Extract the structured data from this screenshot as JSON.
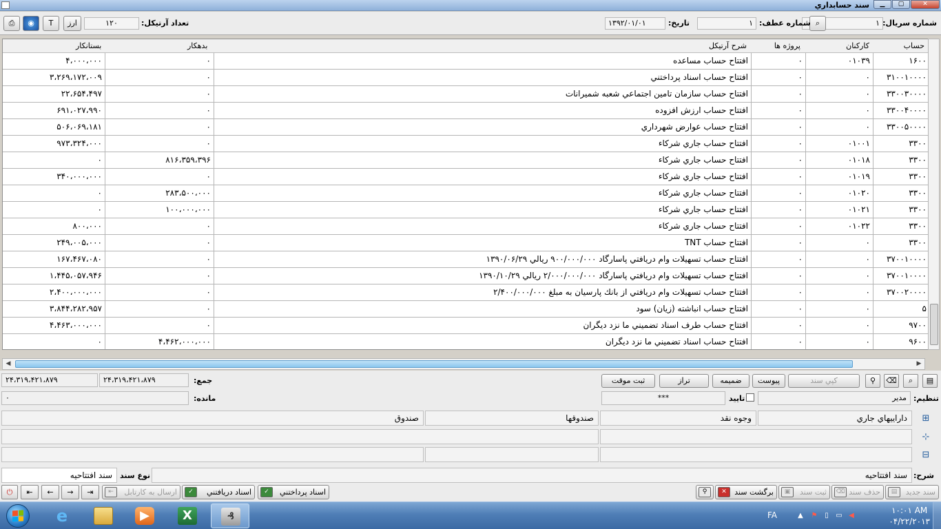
{
  "window": {
    "title": "سند حسابداري",
    "min": "▁",
    "max": "▢",
    "close": "✕"
  },
  "header": {
    "serial_label": "شماره سريال:",
    "serial_value": "۱",
    "atf_label": "شماره عطف:",
    "atf_value": "۱",
    "date_label": "تاريخ:",
    "date_value": "۱۳۹۲/۰۱/۰۱",
    "article_count_label": "تعداد آرتيكل:",
    "article_count_value": "۱۲۰",
    "btn_arz": "ارز",
    "btn_t": "T"
  },
  "grid": {
    "columns": [
      "حساب",
      "كاركنان",
      "پروژه ها",
      "شرح آرتيكل",
      "بدهكار",
      "بستانكار"
    ],
    "rows": [
      [
        "۱۶۰۰",
        "۰۱۰۳۹",
        "۰",
        "افتتاح حساب مساعده",
        "۰",
        "۴،۰۰۰،۰۰۰"
      ],
      [
        "۳۱۰۰۱۰۰۰۰",
        "۰",
        "۰",
        "افتتاح حساب اسناد پرداختني",
        "۰",
        "۳،۲۶۹،۱۷۲،۰۰۹"
      ],
      [
        "۳۳۰۰۳۰۰۰۰",
        "۰",
        "۰",
        "افتتاح حساب سازمان تامين اجتماعي شعبه شميرانات",
        "۰",
        "۲۲،۶۵۴،۴۹۷"
      ],
      [
        "۳۳۰۰۴۰۰۰۰",
        "۰",
        "۰",
        "افتتاح حساب ارزش افزوده",
        "۰",
        "۶۹۱،۰۲۷،۹۹۰"
      ],
      [
        "۳۳۰۰۵۰۰۰۰",
        "۰",
        "۰",
        "افتتاح حساب عوارض شهرداري",
        "۰",
        "۵۰۶،۰۶۹،۱۸۱"
      ],
      [
        "۳۳۰۰",
        "۰۱۰۰۱",
        "۰",
        "افتتاح حساب جاري شركاء",
        "۰",
        "۹۷۳،۳۲۴،۰۰۰"
      ],
      [
        "۳۳۰۰",
        "۰۱۰۱۸",
        "۰",
        "افتتاح حساب جاري شركاء",
        "۸۱۶،۳۵۹،۳۹۶",
        "۰"
      ],
      [
        "۳۳۰۰",
        "۰۱۰۱۹",
        "۰",
        "افتتاح حساب جاري شركاء",
        "۰",
        "۳۴۰،۰۰۰،۰۰۰"
      ],
      [
        "۳۳۰۰",
        "۰۱۰۲۰",
        "۰",
        "افتتاح حساب جاري شركاء",
        "۲۸۳،۵۰۰،۰۰۰",
        "۰"
      ],
      [
        "۳۳۰۰",
        "۰۱۰۲۱",
        "۰",
        "افتتاح حساب جاري شركاء",
        "۱۰۰،۰۰۰،۰۰۰",
        "۰"
      ],
      [
        "۳۳۰۰",
        "۰۱۰۲۲",
        "۰",
        "افتتاح حساب جاري شركاء",
        "۰",
        "۸۰۰،۰۰۰"
      ],
      [
        "۳۳۰۰",
        "۰",
        "۰",
        "افتتاح حساب TNT",
        "۰",
        "۲۴۹،۰۰۵،۰۰۰"
      ],
      [
        "۳۷۰۰۱۰۰۰۰",
        "۰",
        "۰",
        "افتتاح حساب تسهيلات وام دريافتي پاسارگاد ۹۰۰/۰۰۰/۰۰۰ ريالي ۱۳۹۰/۰۶/۲۹",
        "۰",
        "۱۶۷،۴۶۷،۰۸۰"
      ],
      [
        "۳۷۰۰۱۰۰۰۰",
        "۰",
        "۰",
        "افتتاح حساب تسهيلات وام دريافتي پاسارگاد ۲/۰۰۰/۰۰۰/۰۰۰ ريالي ۱۳۹۰/۱۰/۲۹",
        "۰",
        "۱،۴۴۵،۰۵۷،۹۴۶"
      ],
      [
        "۳۷۰۰۲۰۰۰۰",
        "۰",
        "۰",
        "افتتاح حساب تسهيلات وام دريافتي از بانك پارسيان به مبلغ ۲/۴۰۰/۰۰۰/۰۰۰",
        "۰",
        "۲،۴۰۰،۰۰۰،۰۰۰"
      ],
      [
        "۵",
        "۰",
        "۰",
        "افتتاح حساب انباشته (زيان) سود",
        "۰",
        "۳،۸۴۴،۲۸۲،۹۵۷"
      ],
      [
        "۹۷۰۰",
        "۰",
        "۰",
        "افتتاح حساب طرف اسناد تضميني ما نزد ديگران",
        "۰",
        "۴،۴۶۳،۰۰۰،۰۰۰"
      ],
      [
        "۹۶۰۰",
        "۰",
        "۰",
        "افتتاح حساب اسناد تضميني ما نزد ديگران",
        "۴،۴۶۲،۰۰۰،۰۰۰",
        "۰"
      ]
    ]
  },
  "summary": {
    "btn_temp": "ثبت موقت",
    "btn_balance": "تراز",
    "btn_attach": "ضميمه",
    "btn_pivot": "پيوست",
    "btn_copy": "كپي سند",
    "sum_label": "جمع:",
    "sum_debit": "۲۴،۳۱۹،۴۲۱،۸۷۹",
    "sum_credit": "۲۴،۳۱۹،۴۲۱،۸۷۹",
    "remain_label": "مانده:",
    "remain_value": "۰",
    "arrange_label": "تنظيم:",
    "arrange_value": "مدير",
    "approve_label": "تاييد",
    "approve_value": "***"
  },
  "accounts": {
    "row1": [
      "داراييهاي جاري",
      "وجوه نقد",
      "صندوقها",
      "صندوق"
    ],
    "row2": [
      "",
      "",
      "",
      ""
    ],
    "row3": [
      "",
      "",
      "",
      ""
    ]
  },
  "description": {
    "sharh_label": "شرح:",
    "sharh_value": "سند افتتاحيه",
    "doc_type_label": "نوع سند",
    "doc_type_value": "سند افتتاحيه"
  },
  "toolbar": {
    "new_doc": "سند جديد",
    "delete_doc": "حذف سند",
    "save_doc": "ثبت سند",
    "return_doc": "برگشت سند",
    "payable_docs": "اسناد پرداختني",
    "receivable_docs": "اسناد دريافتني",
    "send_cartable": "ارسال به كارتابل"
  },
  "taskbar": {
    "lang": "FA",
    "time": "۱۰:۰۱ AM",
    "date": "۰۴/۲۲/۲۰۱۳"
  },
  "colors": {
    "grid_border": "#b5b5b5",
    "taskbar": "#4f7eb6",
    "scroll_thumb": "#8cc6ee"
  }
}
